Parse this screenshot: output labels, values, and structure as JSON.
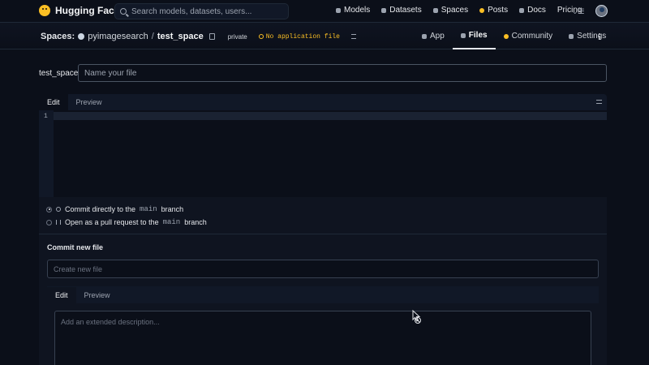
{
  "topnav": {
    "brand": "Hugging Face",
    "search_placeholder": "Search models, datasets, users...",
    "links": [
      {
        "label": "Models",
        "icon": "cube-icon"
      },
      {
        "label": "Datasets",
        "icon": "database-icon"
      },
      {
        "label": "Spaces",
        "icon": "grid-icon"
      },
      {
        "label": "Posts",
        "icon": "posts-icon"
      },
      {
        "label": "Docs",
        "icon": "book-icon"
      },
      {
        "label": "Pricing",
        "icon": ""
      }
    ],
    "more_label": "⌄☰"
  },
  "repo": {
    "section": "Spaces:",
    "owner": "pyimagesearch",
    "separator": "/",
    "name": "test_space",
    "visibility": "private",
    "status": "No application file"
  },
  "tabs": [
    {
      "label": "App",
      "active": false
    },
    {
      "label": "Files",
      "active": true
    },
    {
      "label": "Community",
      "active": false
    },
    {
      "label": "Settings",
      "active": false
    }
  ],
  "file": {
    "path_prefix": "test_space/",
    "name_placeholder": "Name your file",
    "editor_tabs": [
      "Edit",
      "Preview"
    ],
    "line_number": "1"
  },
  "commit": {
    "option_direct_pre": "Commit directly to the",
    "option_pr_pre": "Open as a pull request to the",
    "branch": "main",
    "option_post": "branch",
    "title_label": "Commit new file",
    "title_placeholder": "Create new file",
    "desc_tabs": [
      "Edit",
      "Preview"
    ],
    "desc_placeholder": "Add an extended description..."
  },
  "colors": {
    "background": "#0b0f19",
    "status_warning": "#fbbf24"
  }
}
